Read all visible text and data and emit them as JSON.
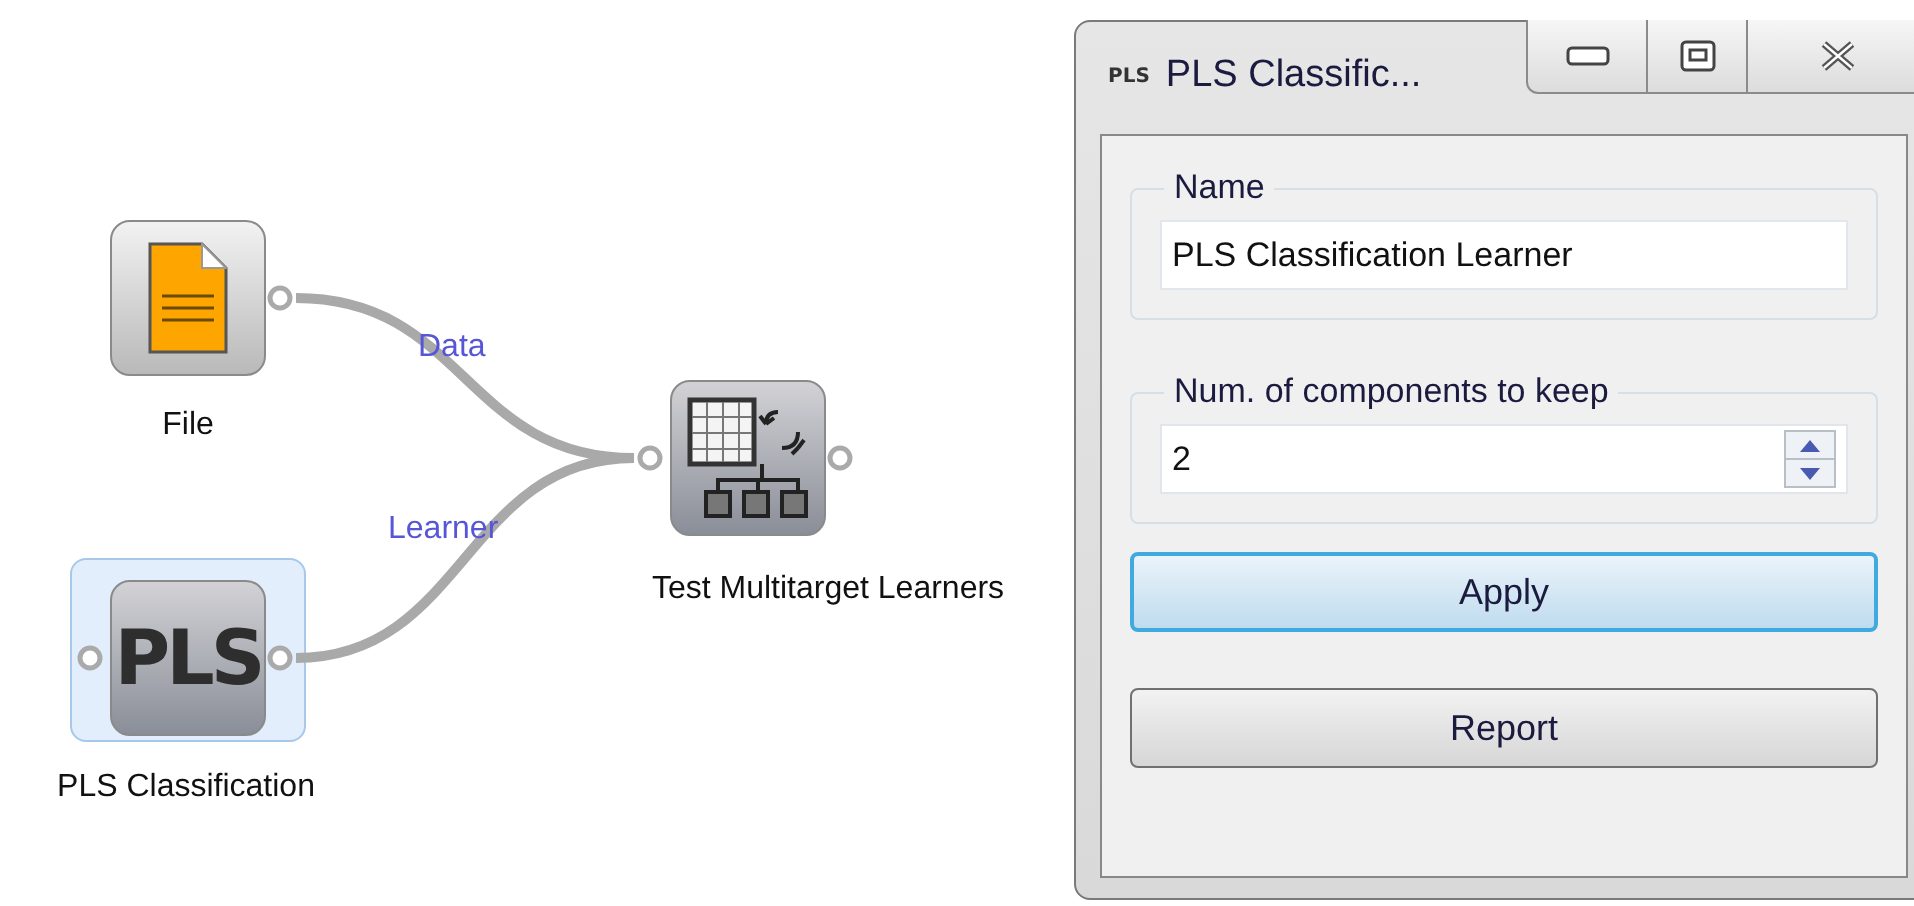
{
  "canvas": {
    "nodes": [
      {
        "label": "File",
        "kind": "file",
        "selected": false
      },
      {
        "label": "PLS Classification",
        "kind": "text",
        "icon_text": "PLS",
        "selected": true
      },
      {
        "label": "Test Multitarget Learners",
        "kind": "test",
        "selected": false
      }
    ],
    "links": [
      {
        "label": "Data"
      },
      {
        "label": "Learner"
      }
    ]
  },
  "dialog": {
    "icon_text": "PLS",
    "title": "PLS Classific...",
    "groups": [
      {
        "title": "Name",
        "kind": "text",
        "value": "PLS Classification Learner"
      },
      {
        "title": "Num. of components to keep",
        "kind": "spin",
        "value": "2"
      }
    ],
    "buttons": [
      {
        "label": "Apply",
        "default": true
      },
      {
        "label": "Report",
        "default": false
      }
    ]
  }
}
